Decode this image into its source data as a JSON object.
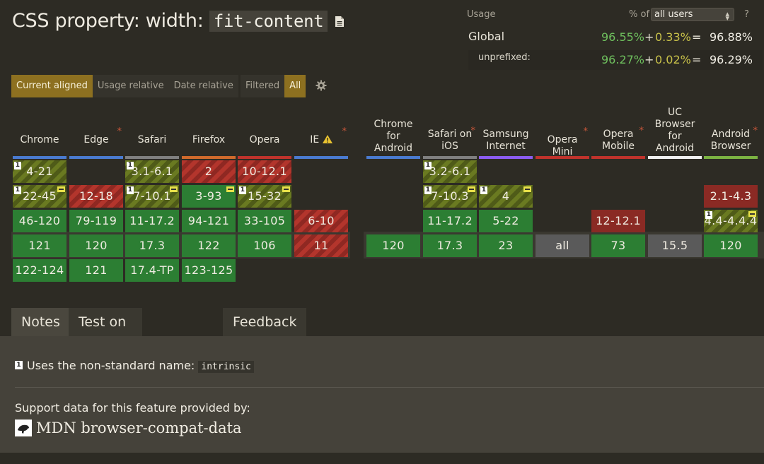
{
  "title": {
    "prefix": "CSS property: width: ",
    "code": "fit-content"
  },
  "usage": {
    "label": "Usage",
    "pct_of": "% of",
    "select_value": "all users",
    "help": "?",
    "global": {
      "label": "Global",
      "supported": "96.55%",
      "plus": "+",
      "partial": "0.33%",
      "eq": "=",
      "total": "96.88%"
    },
    "unprefixed": {
      "label": "unprefixed:",
      "supported": "96.27%",
      "plus": "+",
      "partial": "0.02%",
      "eq": "=",
      "total": "96.29%"
    }
  },
  "view_buttons": [
    "Current aligned",
    "Usage relative",
    "Date relative"
  ],
  "filter_buttons": [
    "Filtered",
    "All"
  ],
  "browsers": {
    "chrome": "Chrome",
    "edge": "Edge",
    "safari": "Safari",
    "firefox": "Firefox",
    "opera": "Opera",
    "ie": "IE",
    "chrome_android": "Chrome for Android",
    "safari_ios": "Safari on iOS",
    "samsung": "Samsung Internet",
    "opera_mini": "Opera Mini",
    "opera_mobile": "Opera Mobile",
    "uc": "UC Browser for Android",
    "android": "Android Browser"
  },
  "cells": {
    "chrome": [
      "4-21",
      "22-45",
      "46-120",
      "121",
      "122-124"
    ],
    "edge": [
      "12-18",
      "79-119",
      "120",
      "121"
    ],
    "safari": [
      "3.1-6.1",
      "7-10.1",
      "11-17.2",
      "17.3",
      "17.4-TP"
    ],
    "firefox": [
      "2",
      "3-93",
      "94-121",
      "122",
      "123-125"
    ],
    "opera": [
      "10-12.1",
      "15-32",
      "33-105",
      "106"
    ],
    "ie": [
      "6-10",
      "11"
    ],
    "chrome_android": [
      "120"
    ],
    "safari_ios": [
      "3.2-6.1",
      "7-10.3",
      "11-17.2",
      "17.3"
    ],
    "samsung": [
      "4",
      "5-22",
      "23"
    ],
    "opera_mini": [
      "all"
    ],
    "opera_mobile": [
      "12-12.1",
      "73"
    ],
    "uc": [
      "15.5"
    ],
    "android": [
      "2.1-4.3",
      "4.4-4.4.4",
      "120"
    ]
  },
  "tabs": [
    "Notes",
    "Test on a real browser",
    "Feedback"
  ],
  "notes": {
    "note_number": "1",
    "note1_text": "Uses the non-standard name: ",
    "note1_code": "intrinsic",
    "support_text": "Support data for this feature provided by:",
    "mdn": "MDN browser-compat-data"
  },
  "colors": {
    "supported": "#2c7e33",
    "unsupported": "#b3352c",
    "partial": "#6a7a21",
    "unknown": "#5a5a5a",
    "accent": "#8d7020"
  },
  "icons": [
    "document-icon",
    "settings-gear-icon",
    "warning-icon",
    "note-marker-icon",
    "prefix-flag-icon",
    "mdn-logo-icon"
  ]
}
